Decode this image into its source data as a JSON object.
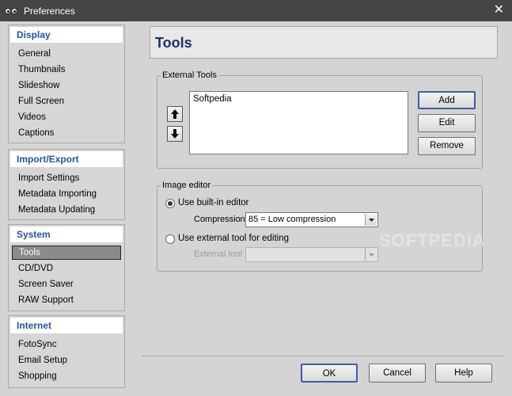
{
  "window": {
    "title": "Preferences"
  },
  "sidebar": {
    "display": {
      "label": "Display",
      "items": [
        "General",
        "Thumbnails",
        "Slideshow",
        "Full Screen",
        "Videos",
        "Captions"
      ]
    },
    "import_export": {
      "label": "Import/Export",
      "items": [
        "Import Settings",
        "Metadata Importing",
        "Metadata Updating"
      ]
    },
    "system": {
      "label": "System",
      "items": [
        "Tools",
        "CD/DVD",
        "Screen Saver",
        "RAW Support"
      ]
    },
    "internet": {
      "label": "Internet",
      "items": [
        "FotoSync",
        "Email Setup",
        "Shopping"
      ]
    }
  },
  "page": {
    "title": "Tools"
  },
  "external_tools": {
    "legend": "External Tools",
    "list": [
      "Softpedia"
    ],
    "add_label": "Add",
    "edit_label": "Edit",
    "remove_label": "Remove"
  },
  "image_editor": {
    "legend": "Image editor",
    "builtin_label": "Use built-in editor",
    "compression_label": "Compression",
    "compression_value": "85 = Low compression",
    "external_label": "Use external tool for editing",
    "external_tool_label": "External tool",
    "external_tool_value": ""
  },
  "footer": {
    "ok": "OK",
    "cancel": "Cancel",
    "help": "Help"
  },
  "watermark": "SOFTPEDIA"
}
